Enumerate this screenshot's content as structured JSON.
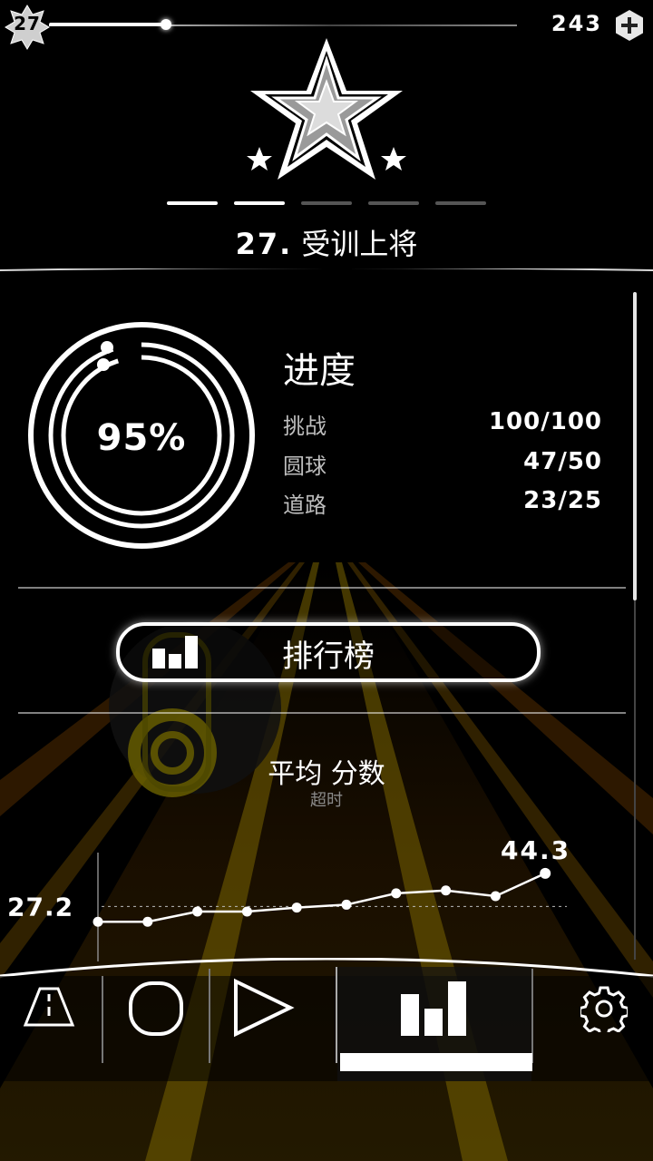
{
  "header": {
    "level": "27",
    "coins": "243",
    "add_icon": "plus-icon",
    "xp_progress": 0.25
  },
  "rank": {
    "number": "27.",
    "title": "受训上将",
    "tiers_filled": 2,
    "tiers_total": 5,
    "icon": "star-rank-icon"
  },
  "progress": {
    "title": "进度",
    "percent_text": "95%",
    "percent": 95,
    "rows": [
      {
        "label": "挑战",
        "value": "100/100"
      },
      {
        "label": "圆球",
        "value": "47/50"
      },
      {
        "label": "道路",
        "value": "23/25"
      }
    ]
  },
  "leaderboard": {
    "label": "排行榜",
    "icon": "bar-chart-icon"
  },
  "stats": {
    "title": "平均 分数",
    "subtitle": "超时"
  },
  "chart_data": {
    "type": "line",
    "title": "平均 分数",
    "subtitle": "超时",
    "x": [
      1,
      2,
      3,
      4,
      5,
      6,
      7,
      8,
      9,
      10
    ],
    "values": [
      24.5,
      24.5,
      26.3,
      26.3,
      27.0,
      27.5,
      29.5,
      30.0,
      29.0,
      33.0
    ],
    "first_label": "27.2",
    "average_line": 27.2,
    "last_label": "44.3",
    "ylim": [
      22,
      36
    ]
  },
  "nav": {
    "items": [
      {
        "name": "road",
        "icon": "road-icon"
      },
      {
        "name": "ball",
        "icon": "ball-icon"
      },
      {
        "name": "play",
        "icon": "play-icon"
      },
      {
        "name": "stats",
        "icon": "bar-chart-icon",
        "active": true
      }
    ],
    "settings_icon": "gear-icon"
  },
  "colors": {
    "background": "#000000",
    "foreground": "#ffffff",
    "muted_text": "#bdbdbd",
    "road_glow": "#c8a000"
  }
}
